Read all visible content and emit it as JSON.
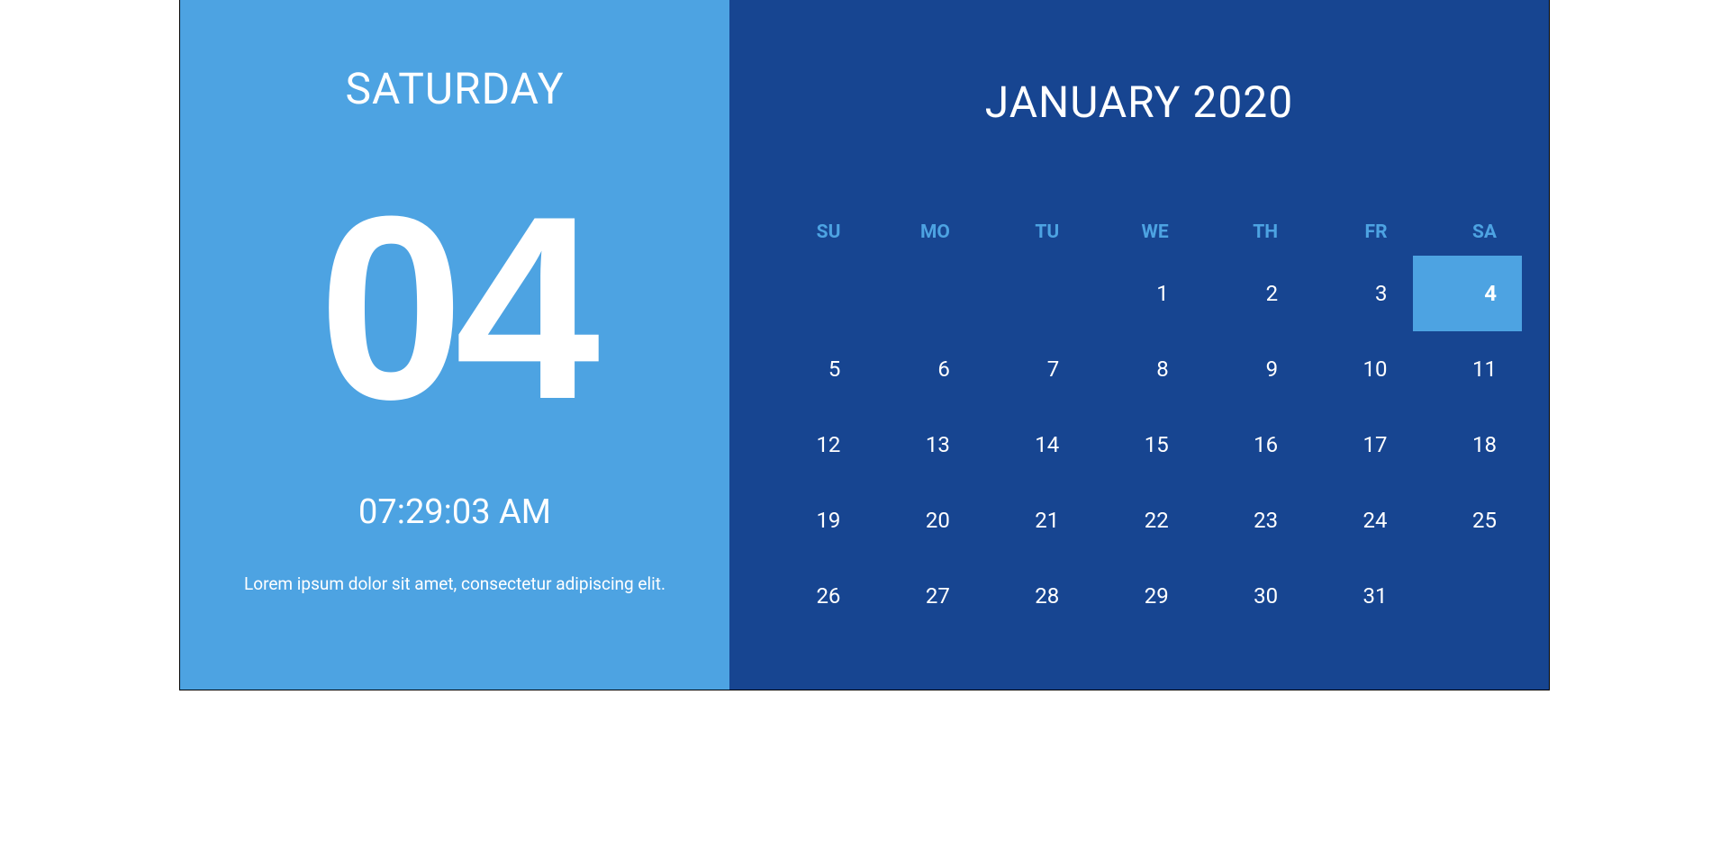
{
  "left": {
    "weekday": "SATURDAY",
    "day_number": "04",
    "time": "07:29:03 AM",
    "description": "Lorem ipsum dolor sit amet, consectetur adipiscing elit."
  },
  "right": {
    "month_label": "JANUARY 2020",
    "weekday_headers": [
      "SU",
      "MO",
      "TU",
      "WE",
      "TH",
      "FR",
      "SA"
    ],
    "first_day_index": 3,
    "days_in_month": 31,
    "selected_day": 4
  }
}
